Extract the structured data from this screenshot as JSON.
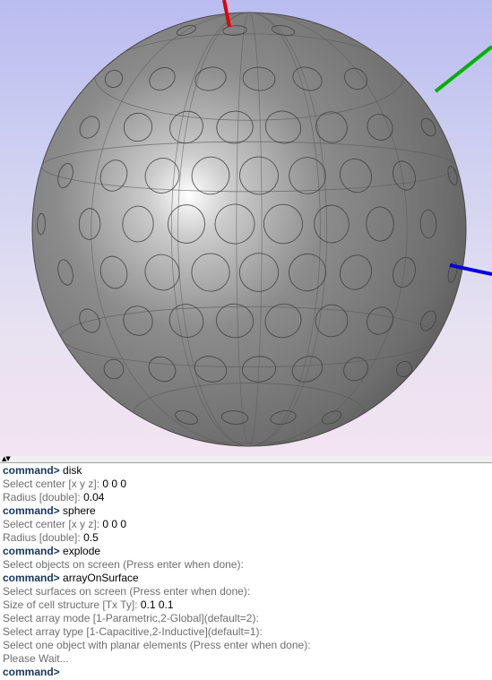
{
  "colors": {
    "sphere": "#8a8a8a",
    "axis_x": "#e00000",
    "axis_y": "#00b000",
    "axis_z": "#0000e0",
    "prompt": "#17365d",
    "label": "#6e6e6e"
  },
  "splitter": {
    "icon": "up-down-arrows"
  },
  "console": {
    "prompt": "command>",
    "lines": [
      {
        "type": "command",
        "text": "disk"
      },
      {
        "type": "output",
        "label": "Select center [x y z]: ",
        "value": "0 0 0"
      },
      {
        "type": "output",
        "label": "Radius [double]: ",
        "value": "0.04"
      },
      {
        "type": "command",
        "text": "sphere"
      },
      {
        "type": "output",
        "label": "Select center [x y z]: ",
        "value": "0 0 0"
      },
      {
        "type": "output",
        "label": "Radius [double]: ",
        "value": "0.5"
      },
      {
        "type": "command",
        "text": "explode"
      },
      {
        "type": "output",
        "label": "Select objects on screen (Press enter when done):",
        "value": ""
      },
      {
        "type": "command",
        "text": "arrayOnSurface"
      },
      {
        "type": "output",
        "label": "Select surfaces on screen (Press enter when done):",
        "value": ""
      },
      {
        "type": "output",
        "label": "Size of cell structure [Tx Ty]: ",
        "value": "0.1 0.1"
      },
      {
        "type": "output",
        "label": "Select array mode [1-Parametric,2-Global](default=2):",
        "value": ""
      },
      {
        "type": "output",
        "label": "Select array type [1-Capacitive,2-Inductive](default=1):",
        "value": ""
      },
      {
        "type": "output",
        "label": "Select one object with planar elements (Press enter when done):",
        "value": ""
      },
      {
        "type": "output",
        "label": "Please Wait...",
        "value": ""
      },
      {
        "type": "command",
        "text": ""
      }
    ]
  }
}
